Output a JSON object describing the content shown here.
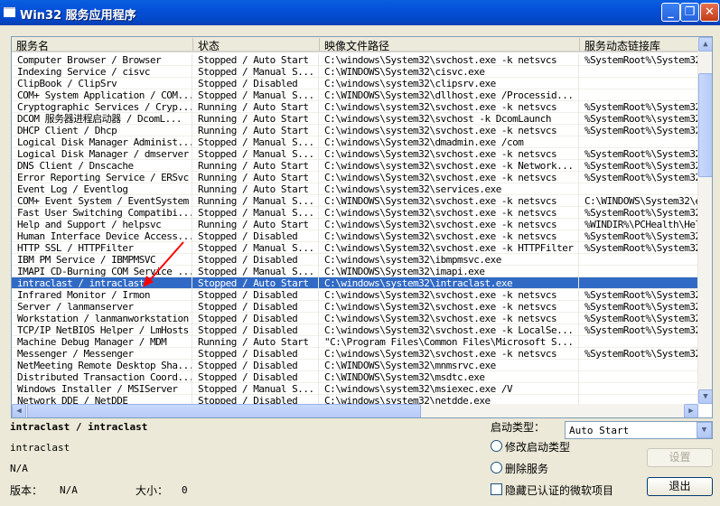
{
  "window": {
    "title": "Win32 服务应用程序"
  },
  "columns": [
    "服务名",
    "状态",
    "映像文件路径",
    "服务动态链接库"
  ],
  "rows": [
    [
      "Computer Browser / Browser",
      "Stopped / Auto Start",
      "C:\\windows\\System32\\svchost.exe -k netsvcs",
      "%SystemRoot%\\System32"
    ],
    [
      "Indexing Service / cisvc",
      "Stopped / Manual S...",
      "C:\\WINDOWS\\System32\\cisvc.exe",
      ""
    ],
    [
      "ClipBook / ClipSrv",
      "Stopped / Disabled",
      "C:\\windows\\system32\\clipsrv.exe",
      ""
    ],
    [
      "COM+ System Application / COM...",
      "Stopped / Manual S...",
      "C:\\WINDOWS\\System32\\dllhost.exe /Processid...",
      ""
    ],
    [
      "Cryptographic Services / Cryp...",
      "Running / Auto Start",
      "C:\\windows\\system32\\svchost.exe -k netsvcs",
      "%SystemRoot%\\System32"
    ],
    [
      "DCOM 服务器进程启动器 / DcomL...",
      "Running / Auto Start",
      "C:\\windows\\system32\\svchost -k DcomLaunch",
      "%SystemRoot%\\system32"
    ],
    [
      "DHCP Client / Dhcp",
      "Running / Auto Start",
      "C:\\windows\\system32\\svchost.exe -k netsvcs",
      "%SystemRoot%\\System32"
    ],
    [
      "Logical Disk Manager Administ...",
      "Stopped / Manual S...",
      "C:\\windows\\System32\\dmadmin.exe /com",
      ""
    ],
    [
      "Logical Disk Manager / dmserver",
      "Stopped / Manual S...",
      "C:\\windows\\System32\\svchost.exe -k netsvcs",
      "%SystemRoot%\\System32"
    ],
    [
      "DNS Client / Dnscache",
      "Running / Auto Start",
      "C:\\windows\\system32\\svchost.exe -k Network...",
      "%SystemRoot%\\System32"
    ],
    [
      "Error Reporting Service / ERSvc",
      "Running / Auto Start",
      "C:\\windows\\System32\\svchost.exe -k netsvcs",
      "%SystemRoot%\\System32"
    ],
    [
      "Event Log / Eventlog",
      "Running / Auto Start",
      "C:\\windows\\system32\\services.exe",
      ""
    ],
    [
      "COM+ Event System / EventSystem",
      "Running / Manual S...",
      "C:\\WINDOWS\\System32\\svchost.exe -k netsvcs",
      "C:\\WINDOWS\\System32\\e"
    ],
    [
      "Fast User Switching Compatibi...",
      "Stopped / Manual S...",
      "C:\\windows\\System32\\svchost.exe -k netsvcs",
      "%SystemRoot%\\System32"
    ],
    [
      "Help and Support / helpsvc",
      "Running / Auto Start",
      "C:\\windows\\System32\\svchost.exe -k netsvcs",
      "%WINDIR%\\PCHealth\\Hel"
    ],
    [
      "Human Interface Device Access...",
      "Stopped / Disabled",
      "C:\\windows\\System32\\svchost.exe -k netsvcs",
      "%SystemRoot%\\System32"
    ],
    [
      "HTTP SSL / HTTPFilter",
      "Stopped / Manual S...",
      "C:\\windows\\System32\\svchost.exe -k HTTPFilter",
      "%SystemRoot%\\System32"
    ],
    [
      "IBM PM Service / IBMPMSVC",
      "Stopped / Disabled",
      "C:\\windows\\system32\\ibmpmsvc.exe",
      ""
    ],
    [
      "IMAPI CD-Burning COM Service ...",
      "Stopped / Manual S...",
      "C:\\WINDOWS\\System32\\imapi.exe",
      ""
    ],
    [
      "intraclast / intraclast",
      "Stopped / Auto Start",
      "C:\\windows\\system32\\intraclast.exe",
      ""
    ],
    [
      "Infrared Monitor / Irmon",
      "Stopped / Disabled",
      "C:\\windows\\System32\\svchost.exe -k netsvcs",
      "%SystemRoot%\\System32"
    ],
    [
      "Server / lanmanserver",
      "Stopped / Disabled",
      "C:\\windows\\System32\\svchost.exe -k netsvcs",
      "%SystemRoot%\\System32"
    ],
    [
      "Workstation / lanmanworkstation",
      "Stopped / Disabled",
      "C:\\windows\\System32\\svchost.exe -k netsvcs",
      "%SystemRoot%\\System32"
    ],
    [
      "TCP/IP NetBIOS Helper / LmHosts",
      "Stopped / Disabled",
      "C:\\windows\\System32\\svchost.exe -k LocalSe...",
      "%SystemRoot%\\System32"
    ],
    [
      "Machine Debug Manager / MDM",
      "Running / Auto Start",
      "\"C:\\Program Files\\Common Files\\Microsoft S...",
      ""
    ],
    [
      "Messenger / Messenger",
      "Stopped / Disabled",
      "C:\\windows\\System32\\svchost.exe -k netsvcs",
      "%SystemRoot%\\System32"
    ],
    [
      "NetMeeting Remote Desktop Sha...",
      "Stopped / Disabled",
      "C:\\WINDOWS\\System32\\mnmsrvc.exe",
      ""
    ],
    [
      "Distributed Transaction Coord...",
      "Stopped / Disabled",
      "C:\\WINDOWS\\System32\\msdtc.exe",
      ""
    ],
    [
      "Windows Installer / MSIServer",
      "Stopped / Manual S...",
      "C:\\windows\\system32\\msiexec.exe /V",
      ""
    ],
    [
      "Network DDE / NetDDE",
      "Stopped / Disabled",
      "C:\\windows\\system32\\netdde.exe",
      ""
    ]
  ],
  "selected_index": 19,
  "details": {
    "heading": "intraclast / intraclast",
    "name": "intraclast",
    "description": "N/A",
    "version_label": "版本：",
    "version": "N/A",
    "size_label": "大小：",
    "size": "0"
  },
  "controls": {
    "startup_type_label": "启动类型：",
    "startup_type_value": "Auto Start",
    "modify_radio": "修改启动类型",
    "delete_radio": "删除服务",
    "hide_ms_checkbox": "隐藏已认证的微软项目",
    "set_button": "设置",
    "exit_button": "退出"
  },
  "colors": {
    "selection": "#316ac5",
    "annotation_arrow": "#ff0000"
  }
}
